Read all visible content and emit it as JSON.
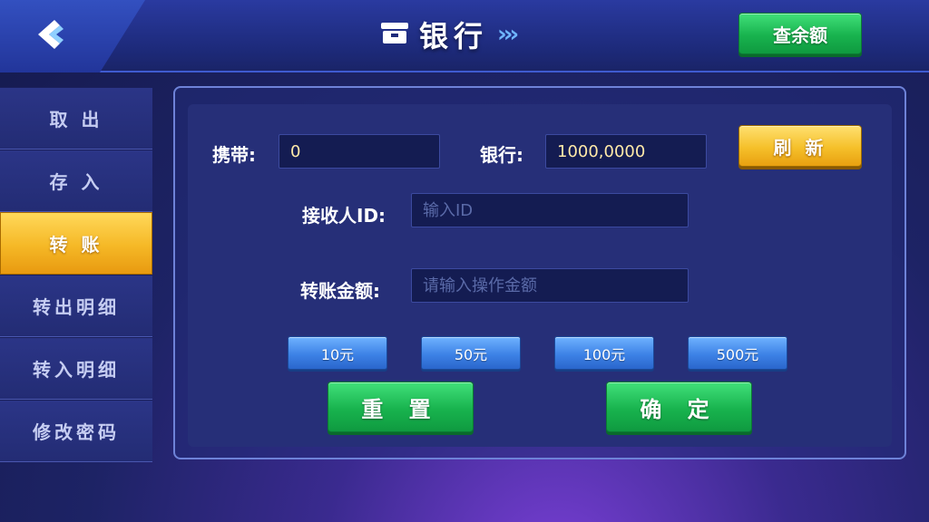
{
  "header": {
    "title": "银行",
    "title_arrows": "›››",
    "query_balance_label": "查余额"
  },
  "sidebar": {
    "items": [
      {
        "label": "取 出"
      },
      {
        "label": "存 入"
      },
      {
        "label": "转 账"
      },
      {
        "label": "转出明细"
      },
      {
        "label": "转入明细"
      },
      {
        "label": "修改密码"
      }
    ]
  },
  "form": {
    "carry_label": "携带:",
    "carry_value": "0",
    "bank_label": "银行:",
    "bank_value": "1000,0000",
    "refresh_label": "刷 新",
    "receiver_label": "接收人ID:",
    "receiver_placeholder": "输入ID",
    "amount_label": "转账金额:",
    "amount_placeholder": "请输入操作金额",
    "quick_amounts": [
      "10元",
      "50元",
      "100元",
      "500元"
    ],
    "reset_label": "重 置",
    "confirm_label": "确 定"
  },
  "colors": {
    "green_button": "#18b34e",
    "gold_active": "#f5b826",
    "blue_amount": "#3d82e6",
    "background": "#1d2365"
  }
}
